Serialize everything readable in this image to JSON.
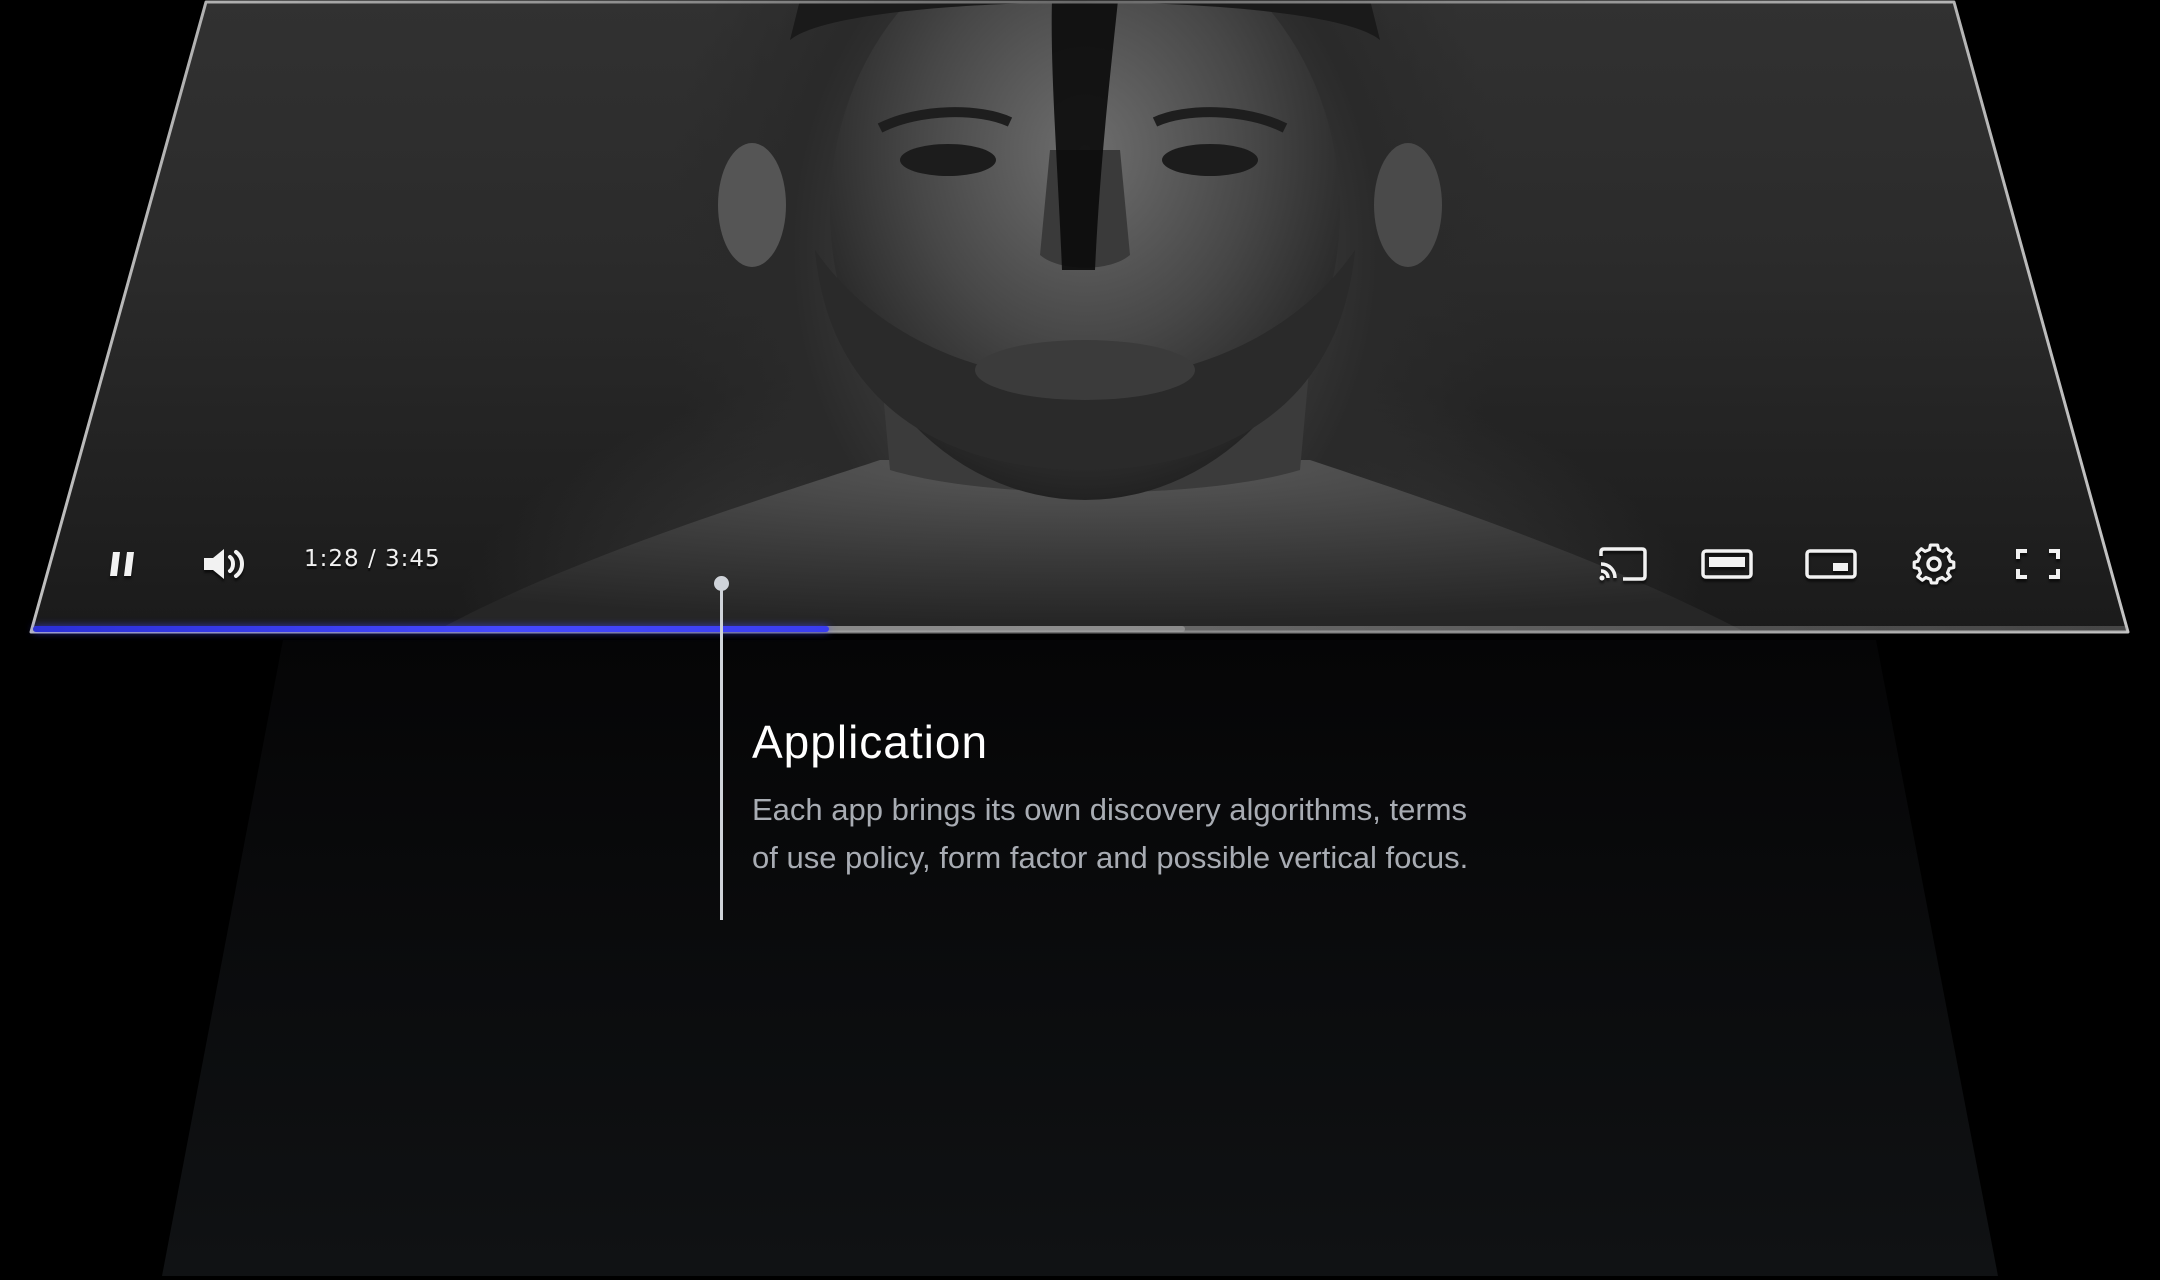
{
  "player": {
    "time_display": "1:28 / 3:45",
    "progress_fraction": 0.38,
    "buffered_fraction": 0.55,
    "accent_color": "#4548ff",
    "controls_left": [
      {
        "icon": "pause-icon"
      },
      {
        "icon": "volume-icon"
      }
    ],
    "controls_right": [
      {
        "icon": "cast-icon"
      },
      {
        "icon": "theater-mode-icon"
      },
      {
        "icon": "miniplayer-icon"
      },
      {
        "icon": "settings-gear-icon"
      },
      {
        "icon": "fullscreen-icon"
      }
    ]
  },
  "annotation": {
    "title": "Application",
    "body": "Each app brings its own discovery algorithms, terms of use policy, form factor and possible vertical focus.",
    "line_color": "#cfd3d9"
  }
}
